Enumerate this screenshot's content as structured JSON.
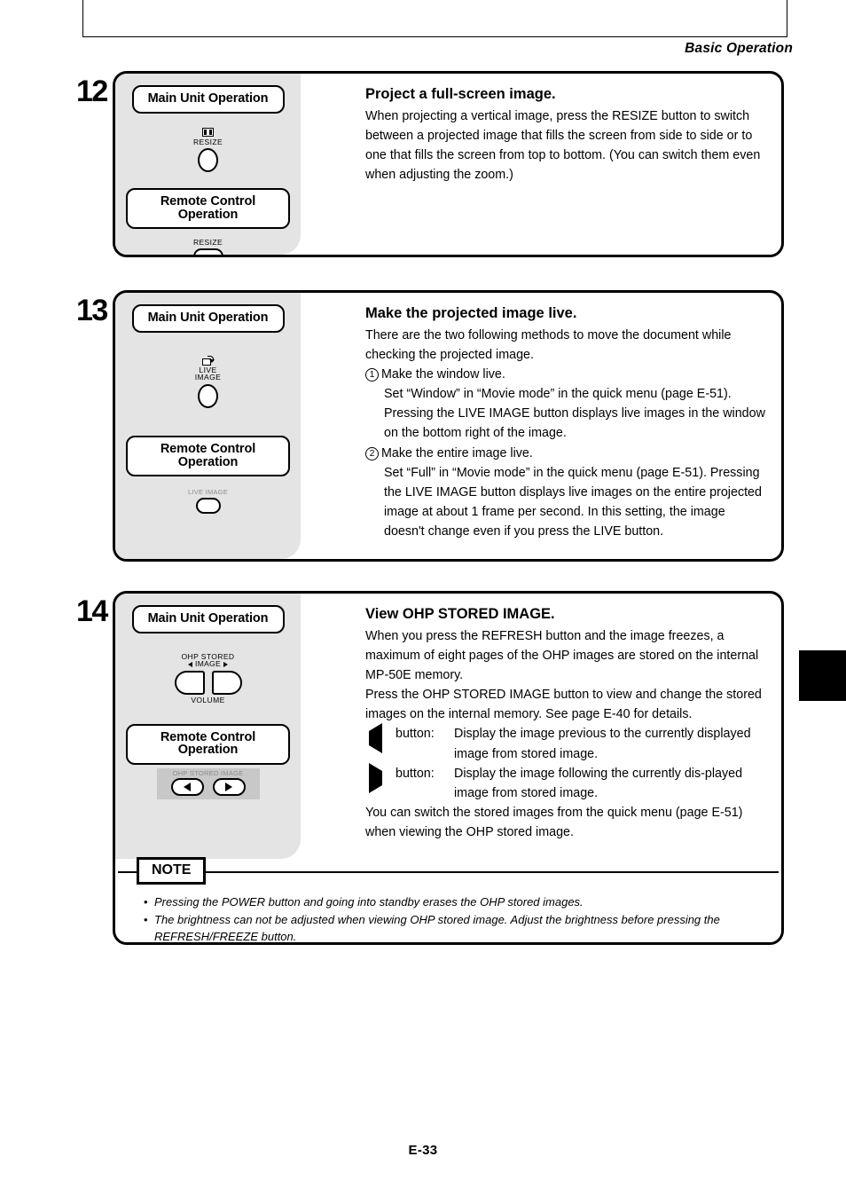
{
  "header": {
    "running_title": "Basic Operation"
  },
  "footer": {
    "page_number": "E-33"
  },
  "labels": {
    "main_unit_operation": "Main Unit Operation",
    "remote_control_operation": "Remote Control Operation",
    "note_tag": "NOTE"
  },
  "sections": [
    {
      "number": "12",
      "title": "Project a full-screen image.",
      "paragraphs": [
        "When projecting a vertical image, press the RESIZE button to switch between a projected image that fills the screen from side to side or to one that fills the screen from top to bottom. (You can switch them even when adjusting the zoom.)"
      ],
      "main_unit": {
        "icon": "resize-expand-icon",
        "caption": "RESIZE",
        "button": "round-button"
      },
      "remote": {
        "caption": "RESIZE",
        "button": "oval-button"
      }
    },
    {
      "number": "13",
      "title": "Make the projected image live.",
      "intro": "There are the two following methods to move the document while checking the projected image.",
      "items": [
        {
          "marker": "1",
          "heading": "Make the window live.",
          "body": "Set “Window” in “Movie mode” in the quick menu (page E-51). Pressing the LIVE IMAGE button displays live images in the window on the bottom right of the image."
        },
        {
          "marker": "2",
          "heading": "Make the entire image live.",
          "body": "Set “Full” in “Movie mode” in the quick menu (page E-51). Pressing the LIVE IMAGE button displays live images on the entire projected image at about 1 frame per second. In this setting, the image doesn't change even if you press the LIVE button."
        }
      ],
      "main_unit": {
        "icon": "live-image-icon",
        "caption_line1": "LIVE",
        "caption_line2": "IMAGE",
        "button": "round-button"
      },
      "remote": {
        "caption": "LIVE IMAGE",
        "button": "oval-button"
      }
    },
    {
      "number": "14",
      "title": "View OHP STORED IMAGE.",
      "paragraphs": [
        "When you press the REFRESH button and the image freezes, a maximum of eight pages of the OHP images are stored on the internal MP-50E memory.",
        "Press the OHP STORED IMAGE button to view and change the stored images on the internal memory. See page E-40 for details."
      ],
      "arrow_rows": [
        {
          "icon": "left-triangle-icon",
          "label": "button:",
          "desc": "Display the image previous to the currently displayed image from stored image."
        },
        {
          "icon": "right-triangle-icon",
          "label": "button:",
          "desc": "Display the image following the currently dis-played image from stored image."
        }
      ],
      "closing": "You can switch the stored images from the quick menu (page E-51) when viewing the OHP stored image.",
      "main_unit": {
        "caption_top_line1": "OHP STORED",
        "caption_top_line2": "IMAGE",
        "caption_bottom": "VOLUME",
        "buttons": [
          "d-button-left",
          "d-button-right"
        ]
      },
      "remote": {
        "caption": "OHP STORED IMAGE",
        "buttons": [
          "left-arrow-oval-button",
          "right-arrow-oval-button"
        ]
      },
      "notes": [
        "Pressing the POWER button and going into standby erases the OHP stored images.",
        "The brightness can not be adjusted when viewing OHP stored image. Adjust the brightness before pressing the REFRESH/FREEZE button."
      ],
      "note_bullet": "•"
    }
  ]
}
